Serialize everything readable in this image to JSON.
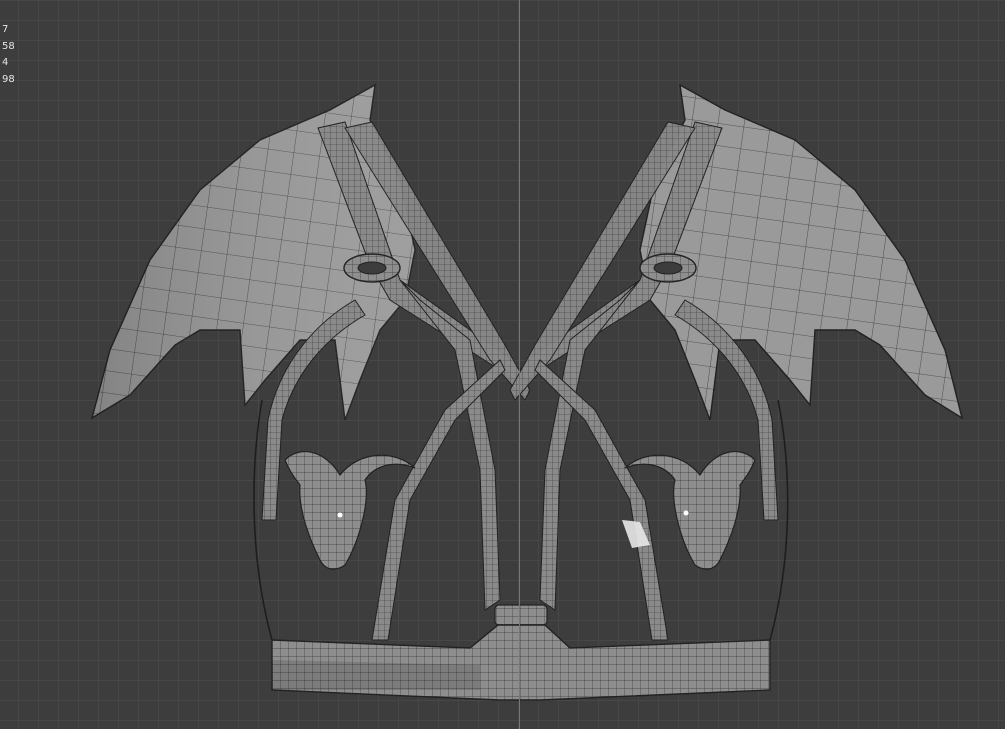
{
  "viewport": {
    "background": "#3d3d3d",
    "grid_color": "#474747",
    "z_axis_color": "#4a7fc4"
  },
  "stats": [
    "7",
    "58",
    "4",
    "98"
  ],
  "model": {
    "mesh_fill": "#8d8d8d",
    "mesh_light": "#b4b4b4",
    "wire_color": "#2b2b2b"
  }
}
